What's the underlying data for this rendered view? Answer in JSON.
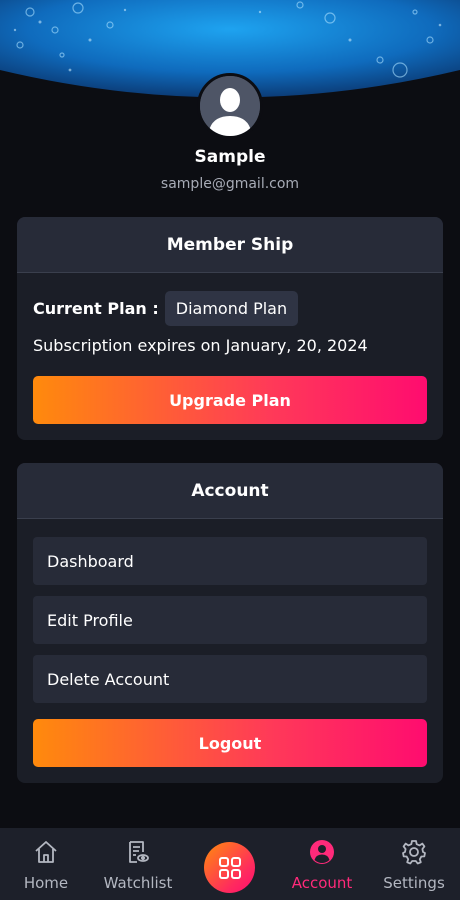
{
  "profile": {
    "name": "Sample",
    "email": "sample@gmail.com",
    "avatar_icon": "user-silhouette-icon"
  },
  "membership": {
    "title": "Member Ship",
    "current_plan_label": "Current Plan :",
    "current_plan_value": "Diamond Plan",
    "expires_text": "Subscription expires on January,  20, 2024",
    "upgrade_label": "Upgrade Plan"
  },
  "account": {
    "title": "Account",
    "items": [
      {
        "label": "Dashboard"
      },
      {
        "label": "Edit Profile"
      },
      {
        "label": "Delete Account"
      }
    ],
    "logout_label": "Logout"
  },
  "bottom_nav": {
    "items": [
      {
        "label": "Home",
        "icon": "home-icon"
      },
      {
        "label": "Watchlist",
        "icon": "watchlist-icon"
      },
      {
        "label": "Account",
        "icon": "account-icon",
        "active": true
      },
      {
        "label": "Settings",
        "icon": "gear-icon"
      }
    ],
    "center_icon": "grid-icon"
  },
  "colors": {
    "background": "#0c0d12",
    "card": "#1b1e27",
    "card_header": "#272b38",
    "accent_pink": "#ff0c6f",
    "accent_orange": "#ff8a0c",
    "active_nav": "#ff2a7a"
  }
}
